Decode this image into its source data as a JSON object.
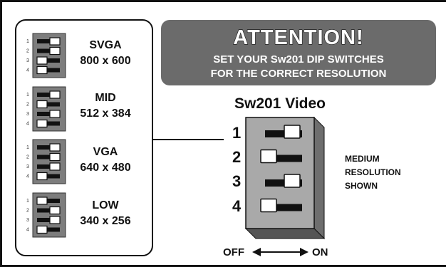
{
  "attention": {
    "title": "ATTENTION!",
    "line1": "SET YOUR Sw201 DIP SWITCHES",
    "line2": "FOR THE CORRECT RESOLUTION"
  },
  "modes": [
    {
      "name": "SVGA",
      "res": "800 x 600",
      "switches": [
        "on",
        "on",
        "off",
        "off"
      ]
    },
    {
      "name": "MID",
      "res": "512 x 384",
      "switches": [
        "on",
        "off",
        "on",
        "off"
      ]
    },
    {
      "name": "VGA",
      "res": "640 x 480",
      "switches": [
        "on",
        "on",
        "on",
        "off"
      ]
    },
    {
      "name": "LOW",
      "res": "340 x 256",
      "switches": [
        "off",
        "on",
        "on",
        "off"
      ]
    }
  ],
  "switch_numbers": [
    "1",
    "2",
    "3",
    "4"
  ],
  "sw201": {
    "title": "Sw201 Video",
    "switches": [
      "on",
      "off",
      "on",
      "off"
    ],
    "note": [
      "MEDIUM",
      "RESOLUTION",
      "SHOWN"
    ],
    "off_label": "OFF",
    "on_label": "ON"
  },
  "colors": {
    "banner": "#6b6b6b",
    "switch_body": "#a9a9a9",
    "mini_body": "#7d7d7d"
  }
}
